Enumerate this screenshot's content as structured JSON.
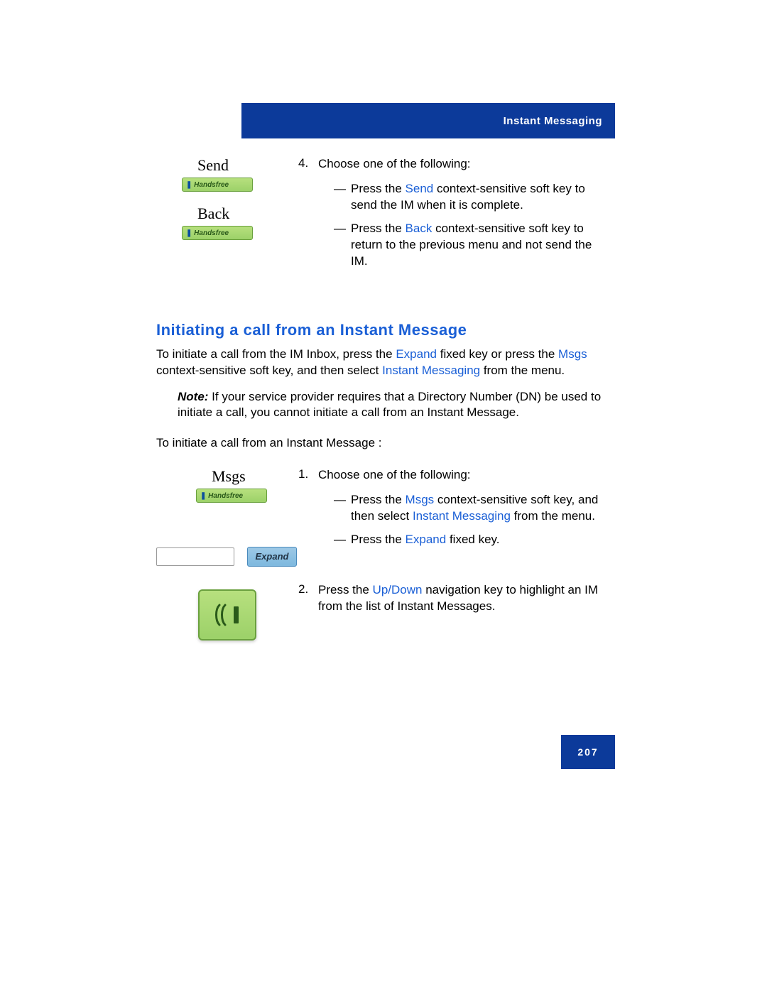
{
  "header": {
    "title": "Instant Messaging"
  },
  "buttons": {
    "send_label": "Send",
    "back_label": "Back",
    "msgs_label": "Msgs",
    "handsfree": "Handsfree",
    "expand": "Expand"
  },
  "step4": {
    "num": "4.",
    "lead": "Choose one of the following:",
    "a": {
      "pre": "Press the ",
      "key": "Send",
      "post": " context-sensitive soft key to send the IM when it is complete."
    },
    "b": {
      "pre": "Press the ",
      "key": "Back",
      "post": " context-sensitive soft key to return to the previous menu and not send the IM."
    }
  },
  "section_heading": "Initiating a call from an Instant Message",
  "intro": {
    "p1a": "To initiate a call from the IM Inbox, press the ",
    "p1key1": "Expand",
    "p1b": " fixed key or press the ",
    "p1key2": "Msgs",
    "p1c": " context-sensitive soft key, and then select ",
    "p1key3": "Instant Messaging",
    "p1d": " from the menu."
  },
  "note": {
    "label": "Note:",
    "text": "  If your service provider requires that a Directory Number (DN) be used to initiate a call, you cannot initiate a call from an Instant Message."
  },
  "lead2": "To initiate a call from an Instant Message    :",
  "step1": {
    "num": "1.",
    "lead": "Choose one of the following:",
    "a": {
      "pre": "Press the ",
      "key": "Msgs",
      "mid": " context-sensitive soft key, and then select ",
      "key2": "Instant Messaging",
      "post": " from the menu."
    },
    "b": {
      "pre": "Press the ",
      "key": "Expand",
      "post": " fixed key."
    }
  },
  "step2": {
    "num": "2.",
    "pre": "Press the ",
    "key": "Up/Down",
    "post": " navigation key to highlight an IM from the list of Instant Messages."
  },
  "page_number": "207"
}
